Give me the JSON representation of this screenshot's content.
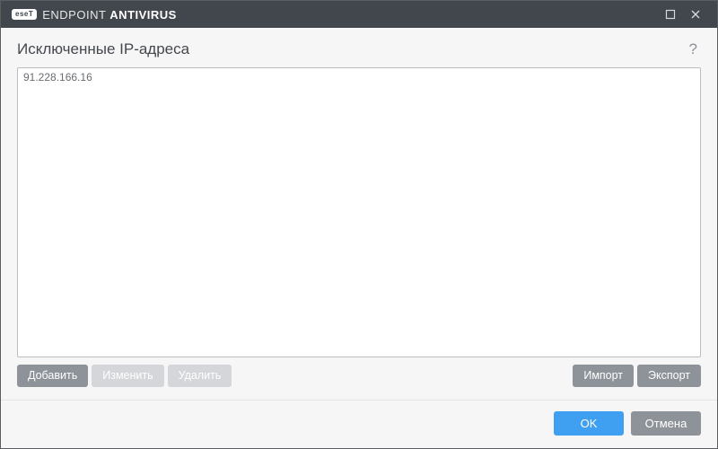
{
  "titlebar": {
    "brand_pill": "eseT",
    "brand_prefix": "ENDPOINT ",
    "brand_suffix": "ANTIVIRUS"
  },
  "heading": "Исключенные IP-адреса",
  "help_glyph": "?",
  "list": {
    "items": [
      {
        "value": "91.228.166.16"
      }
    ]
  },
  "toolbar": {
    "add": "Добавить",
    "edit": "Изменить",
    "delete": "Удалить",
    "import": "Импорт",
    "export": "Экспорт"
  },
  "footer": {
    "ok": "OK",
    "cancel": "Отмена"
  }
}
